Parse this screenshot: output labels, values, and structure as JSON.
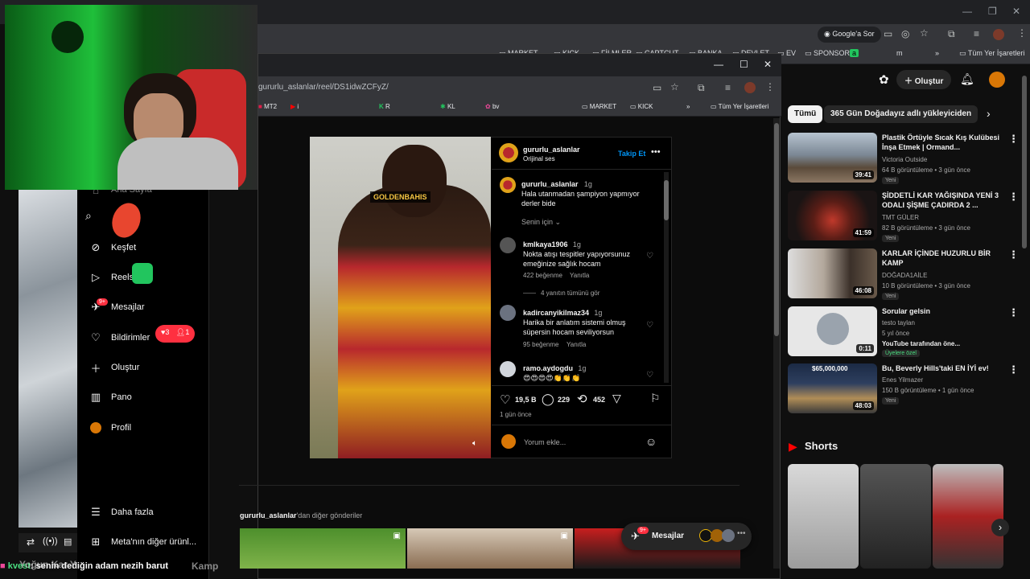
{
  "back_browser": {
    "bookmarks": [
      "MARKET",
      "KICK",
      "FİLMLER",
      "CAPTCUT",
      "BANKA",
      "DEVLET",
      "EV",
      "SPONSOR",
      "a",
      "m"
    ],
    "all_bookmarks": "Tüm Yer İşaretleri",
    "google_lens": "Google'a Sor"
  },
  "front_browser": {
    "url": "gururlu_aslanlar/reel/DS1idwZCFyZ/",
    "bookmarks": [
      "MT2",
      "i",
      "R",
      "KL",
      "bv",
      "MARKET",
      "KICK"
    ],
    "all_bookmarks": "Tüm Yer İşaretleri"
  },
  "instagram": {
    "nav": {
      "home": "Ana Sayfa",
      "explore": "Keşfet",
      "reels": "Reels",
      "messages": "Mesajlar",
      "messages_badge": "9+",
      "notifications": "Bildirimler",
      "notif_likes": "3",
      "notif_follows": "1",
      "create": "Oluştur",
      "dashboard": "Pano",
      "profile": "Profil",
      "more": "Daha fazla",
      "meta": "Meta'nın diğer ürünl..."
    },
    "post": {
      "username": "gururlu_aslanlar",
      "audio": "Orijinal ses",
      "follow": "Takip Et",
      "image_text": "GOLDENBAHIS",
      "caption_user": "gururlu_aslanlar",
      "caption_time": "1g",
      "caption_text": "Hala utanmadan şampiyon yapmıyor derler bide",
      "for_you": "Senin için",
      "likes": "19,5 B",
      "comments": "229",
      "reposts": "452",
      "date": "1 gün önce",
      "comment_placeholder": "Yorum ekle..."
    },
    "comments": [
      {
        "user": "kmlkaya1906",
        "time": "1g",
        "text": "Nokta atışı tespitler yapıyorsunuz emeğinize sağlık hocam",
        "likes": "422 beğenme",
        "reply": "Yanıtla",
        "view_replies": "4 yanıtın tümünü gör"
      },
      {
        "user": "kadircanyikilmaz34",
        "time": "1g",
        "text": "Harika bir anlatım sistemi olmuş süpersin hocam seviliyorsun",
        "likes": "95 beğenme",
        "reply": "Yanıtla"
      },
      {
        "user": "ramo.aydogdu",
        "time": "1g",
        "text": "😍😍😍😍👏👏👏"
      }
    ],
    "more_posts_user": "gururlu_aslanlar",
    "more_posts_suffix": "'dan diğer gönderiler",
    "messages_float": "Mesajlar",
    "messages_float_badge": "9+"
  },
  "youtube": {
    "create": "Oluştur",
    "chips": [
      "Tümü",
      "365 Gün Doğadayız adlı yükleyiciden"
    ],
    "videos": [
      {
        "title": "Plastik Örtüyle Sıcak Kış Kulübesi İnşa Etmek | Ormand...",
        "channel": "Victoria Outside",
        "meta": "64 B görüntüleme • 3 gün önce",
        "badge": "Yeni",
        "duration": "39:41"
      },
      {
        "title": "ŞİDDETLİ KAR YAĞIŞINDA YENİ 3 ODALI ŞİŞME ÇADIRDA 2 ...",
        "channel": "TMT GÜLER",
        "meta": "82 B görüntüleme • 3 gün önce",
        "badge": "Yeni",
        "duration": "41:59"
      },
      {
        "title": "KARLAR İÇİNDE HUZURLU BİR KAMP",
        "channel": "DOĞADA1AİLE",
        "meta": "10 B görüntüleme • 3 gün önce",
        "badge": "Yeni",
        "duration": "46:08"
      },
      {
        "title": "Sorular gelsin",
        "channel": "testo taylan",
        "meta": "5 yıl önce",
        "extra": "YouTube tarafından öne...",
        "badge": "Üyelere özel",
        "duration": "0:11"
      },
      {
        "title": "Bu, Beverly Hills'taki EN İYİ ev!",
        "channel": "Enes Yilmazer",
        "meta": "150 B görüntüleme • 1 gün önce",
        "badge": "Yeni",
        "duration": "48:03",
        "thumb_text": "$65,000,000"
      }
    ],
    "shorts_title": "Shorts"
  },
  "stream": {
    "chat_user": "kvest",
    "chat_text": "senin dediğin adam nezih barut",
    "bottom_left": "Yoğun Kar Y",
    "bottom_right": "Kamp"
  },
  "colors": {
    "ig_blue": "#0095f6",
    "notif_red": "#ff3040",
    "yt_red": "#ff0000",
    "green_screen": "#22c55e"
  }
}
